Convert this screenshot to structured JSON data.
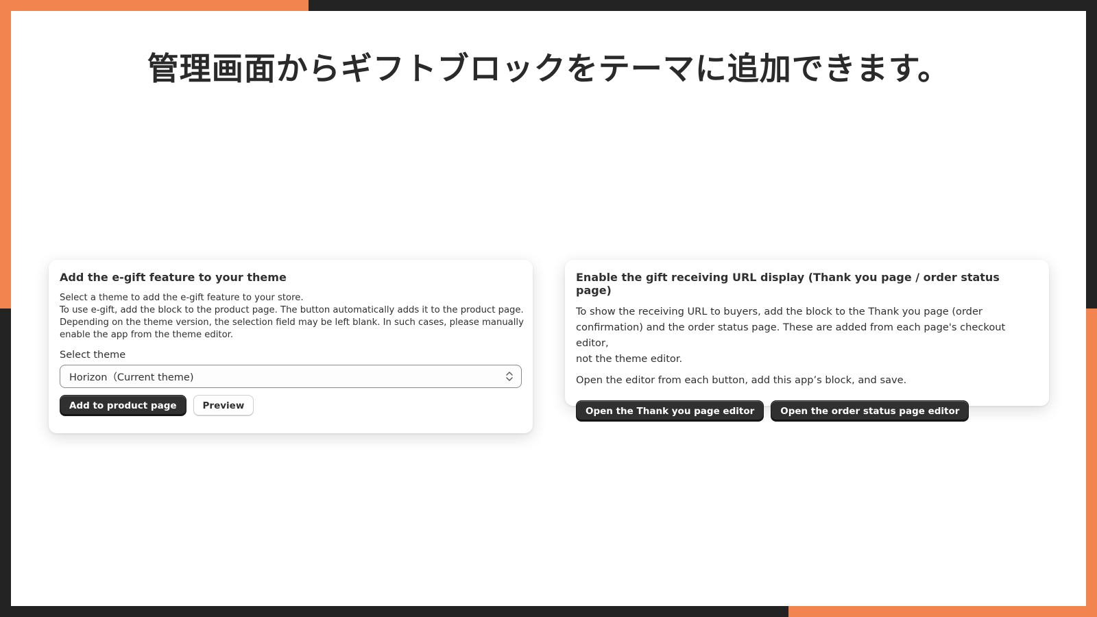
{
  "slide": {
    "title": "管理画面からギフトブロックをテーマに追加できます。"
  },
  "theme_card": {
    "title": "Add the e-gift feature to your theme",
    "description_lines": [
      "Select a theme to add the e-gift feature to your store.",
      "To use e-gift, add the block to the product page. The button automatically adds it to the product page.",
      "Depending on the theme version, the selection field may be left blank. In such cases, please manually",
      "enable the app from the theme editor."
    ],
    "select_label": "Select theme",
    "select_value": "Horizon（Current theme)",
    "add_button": "Add to product page",
    "preview_button": "Preview"
  },
  "url_card": {
    "title": "Enable the gift receiving URL display (Thank you page / order status page)",
    "description_lines": [
      "To show the receiving URL to buyers, add the block to the Thank you page (order",
      "confirmation) and the order status page. These are added from each page's checkout editor,",
      "not the theme editor."
    ],
    "instruction": "Open the editor from each button, add this app’s block, and save.",
    "thank_you_button": "Open the Thank you page editor",
    "order_status_button": "Open the order status page editor"
  },
  "colors": {
    "accent": "#f2844f",
    "frame": "#232323",
    "button_dark": "#303030"
  },
  "icons": {
    "select_chevrons": "chevron-up-down-icon"
  }
}
